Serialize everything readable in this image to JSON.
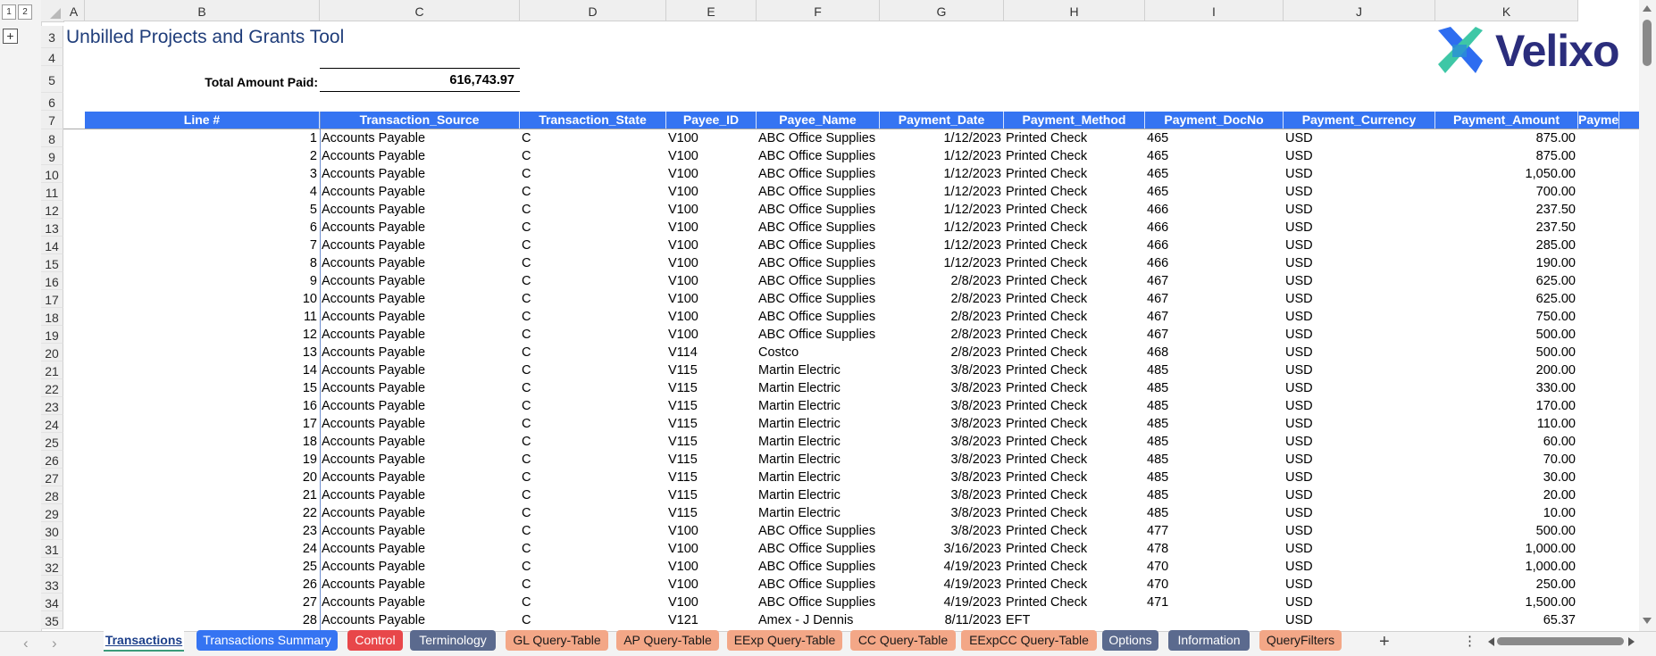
{
  "outline": {
    "level1": "1",
    "level2": "2",
    "expand": "+"
  },
  "columns": [
    "A",
    "B",
    "C",
    "D",
    "E",
    "F",
    "G",
    "H",
    "I",
    "J",
    "K"
  ],
  "rows": [
    "3",
    "4",
    "5",
    "6",
    "7",
    "8",
    "9",
    "10",
    "11",
    "12",
    "13",
    "14",
    "15",
    "16",
    "17",
    "18",
    "19",
    "20",
    "21",
    "22",
    "23",
    "24",
    "25",
    "26",
    "27",
    "28",
    "29",
    "30",
    "31",
    "32",
    "33",
    "34",
    "35"
  ],
  "sheet_title": "Unbilled Projects and Grants Tool",
  "total": {
    "label": "Total Amount Paid:",
    "value": "616,743.97"
  },
  "logo": {
    "text": "Velixo",
    "colors": {
      "blue": "#2e6df0",
      "green": "#3ec7a6",
      "navy": "#2b2d7c"
    }
  },
  "table": {
    "headers": [
      "Line #",
      "Transaction_Source",
      "Transaction_State",
      "Payee_ID",
      "Payee_Name",
      "Payment_Date",
      "Payment_Method",
      "Payment_DocNo",
      "Payment_Currency",
      "Payment_Amount",
      "Payme"
    ],
    "rows": [
      [
        "1",
        "Accounts Payable",
        "C",
        "V100",
        "ABC Office Supplies",
        "1/12/2023",
        "Printed Check",
        "465",
        "USD",
        "875.00"
      ],
      [
        "2",
        "Accounts Payable",
        "C",
        "V100",
        "ABC Office Supplies",
        "1/12/2023",
        "Printed Check",
        "465",
        "USD",
        "875.00"
      ],
      [
        "3",
        "Accounts Payable",
        "C",
        "V100",
        "ABC Office Supplies",
        "1/12/2023",
        "Printed Check",
        "465",
        "USD",
        "1,050.00"
      ],
      [
        "4",
        "Accounts Payable",
        "C",
        "V100",
        "ABC Office Supplies",
        "1/12/2023",
        "Printed Check",
        "465",
        "USD",
        "700.00"
      ],
      [
        "5",
        "Accounts Payable",
        "C",
        "V100",
        "ABC Office Supplies",
        "1/12/2023",
        "Printed Check",
        "466",
        "USD",
        "237.50"
      ],
      [
        "6",
        "Accounts Payable",
        "C",
        "V100",
        "ABC Office Supplies",
        "1/12/2023",
        "Printed Check",
        "466",
        "USD",
        "237.50"
      ],
      [
        "7",
        "Accounts Payable",
        "C",
        "V100",
        "ABC Office Supplies",
        "1/12/2023",
        "Printed Check",
        "466",
        "USD",
        "285.00"
      ],
      [
        "8",
        "Accounts Payable",
        "C",
        "V100",
        "ABC Office Supplies",
        "1/12/2023",
        "Printed Check",
        "466",
        "USD",
        "190.00"
      ],
      [
        "9",
        "Accounts Payable",
        "C",
        "V100",
        "ABC Office Supplies",
        "2/8/2023",
        "Printed Check",
        "467",
        "USD",
        "625.00"
      ],
      [
        "10",
        "Accounts Payable",
        "C",
        "V100",
        "ABC Office Supplies",
        "2/8/2023",
        "Printed Check",
        "467",
        "USD",
        "625.00"
      ],
      [
        "11",
        "Accounts Payable",
        "C",
        "V100",
        "ABC Office Supplies",
        "2/8/2023",
        "Printed Check",
        "467",
        "USD",
        "750.00"
      ],
      [
        "12",
        "Accounts Payable",
        "C",
        "V100",
        "ABC Office Supplies",
        "2/8/2023",
        "Printed Check",
        "467",
        "USD",
        "500.00"
      ],
      [
        "13",
        "Accounts Payable",
        "C",
        "V114",
        "Costco",
        "2/8/2023",
        "Printed Check",
        "468",
        "USD",
        "500.00"
      ],
      [
        "14",
        "Accounts Payable",
        "C",
        "V115",
        "Martin Electric",
        "3/8/2023",
        "Printed Check",
        "485",
        "USD",
        "200.00"
      ],
      [
        "15",
        "Accounts Payable",
        "C",
        "V115",
        "Martin Electric",
        "3/8/2023",
        "Printed Check",
        "485",
        "USD",
        "330.00"
      ],
      [
        "16",
        "Accounts Payable",
        "C",
        "V115",
        "Martin Electric",
        "3/8/2023",
        "Printed Check",
        "485",
        "USD",
        "170.00"
      ],
      [
        "17",
        "Accounts Payable",
        "C",
        "V115",
        "Martin Electric",
        "3/8/2023",
        "Printed Check",
        "485",
        "USD",
        "110.00"
      ],
      [
        "18",
        "Accounts Payable",
        "C",
        "V115",
        "Martin Electric",
        "3/8/2023",
        "Printed Check",
        "485",
        "USD",
        "60.00"
      ],
      [
        "19",
        "Accounts Payable",
        "C",
        "V115",
        "Martin Electric",
        "3/8/2023",
        "Printed Check",
        "485",
        "USD",
        "70.00"
      ],
      [
        "20",
        "Accounts Payable",
        "C",
        "V115",
        "Martin Electric",
        "3/8/2023",
        "Printed Check",
        "485",
        "USD",
        "30.00"
      ],
      [
        "21",
        "Accounts Payable",
        "C",
        "V115",
        "Martin Electric",
        "3/8/2023",
        "Printed Check",
        "485",
        "USD",
        "20.00"
      ],
      [
        "22",
        "Accounts Payable",
        "C",
        "V115",
        "Martin Electric",
        "3/8/2023",
        "Printed Check",
        "485",
        "USD",
        "10.00"
      ],
      [
        "23",
        "Accounts Payable",
        "C",
        "V100",
        "ABC Office Supplies",
        "3/8/2023",
        "Printed Check",
        "477",
        "USD",
        "500.00"
      ],
      [
        "24",
        "Accounts Payable",
        "C",
        "V100",
        "ABC Office Supplies",
        "3/16/2023",
        "Printed Check",
        "478",
        "USD",
        "1,000.00"
      ],
      [
        "25",
        "Accounts Payable",
        "C",
        "V100",
        "ABC Office Supplies",
        "4/19/2023",
        "Printed Check",
        "470",
        "USD",
        "1,000.00"
      ],
      [
        "26",
        "Accounts Payable",
        "C",
        "V100",
        "ABC Office Supplies",
        "4/19/2023",
        "Printed Check",
        "470",
        "USD",
        "250.00"
      ],
      [
        "27",
        "Accounts Payable",
        "C",
        "V100",
        "ABC Office Supplies",
        "4/19/2023",
        "Printed Check",
        "471",
        "USD",
        "1,500.00"
      ],
      [
        "28",
        "Accounts Payable",
        "C",
        "V121",
        "Amex - J Dennis",
        "8/11/2023",
        "EFT",
        "",
        "USD",
        "65.37"
      ]
    ]
  },
  "tabs": [
    {
      "label": "Transactions",
      "color": "#ffffff",
      "text": "#1c3f8a",
      "active": true
    },
    {
      "label": "Transactions Summary",
      "color": "#3574f2",
      "text": "#ffffff"
    },
    {
      "label": "Control",
      "color": "#e8474a",
      "text": "#ffffff"
    },
    {
      "label": "Terminology",
      "color": "#5b6a8e",
      "text": "#ffffff"
    },
    {
      "label": "GL Query-Table",
      "color": "#f3a787",
      "text": "#1a1a1a"
    },
    {
      "label": "AP Query-Table",
      "color": "#f3a787",
      "text": "#1a1a1a"
    },
    {
      "label": "EExp Query-Table",
      "color": "#f3a787",
      "text": "#1a1a1a"
    },
    {
      "label": "CC Query-Table",
      "color": "#f3a787",
      "text": "#1a1a1a"
    },
    {
      "label": "EExpCC Query-Table",
      "color": "#f3a787",
      "text": "#1a1a1a"
    },
    {
      "label": "Options",
      "color": "#5b6a8e",
      "text": "#ffffff"
    },
    {
      "label": "Information",
      "color": "#5b6a8e",
      "text": "#ffffff"
    },
    {
      "label": "QueryFilters",
      "color": "#f3a787",
      "text": "#1a1a1a"
    }
  ],
  "controls": {
    "add_sheet": "+",
    "more": "⋮",
    "prev": "‹",
    "next": "›"
  }
}
